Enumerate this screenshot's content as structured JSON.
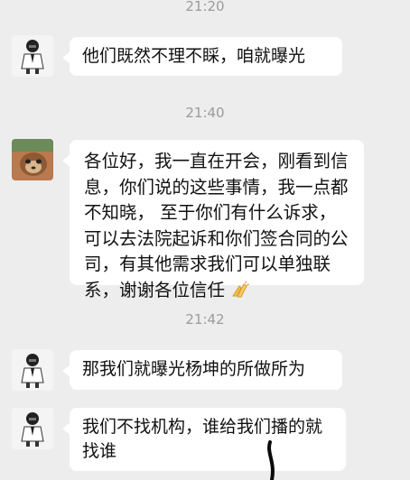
{
  "chat": {
    "messages": [
      {
        "time": "21:20",
        "text": "他们既然不理不睬，咱就曝光"
      },
      {
        "time": "21:40",
        "text": "各位好，我一直在开会，刚看到信息，你们说的这些事情，我一点都不知晓， 至于你们有什么诉求，可以去法院起诉和你们签合同的公司，有其他需求我们可以单独联系，谢谢各位信任",
        "emoji": "folded-hands-emoji"
      },
      {
        "time": "21:42",
        "text": "那我们就曝光杨坤的所做所为"
      },
      {
        "time": "",
        "text": "我们不找机构，谁给我们播的就找谁"
      }
    ]
  },
  "colors": {
    "background": "#ededed",
    "bubble": "#ffffff",
    "timestamp": "#9b9b9b",
    "text": "#111111"
  }
}
